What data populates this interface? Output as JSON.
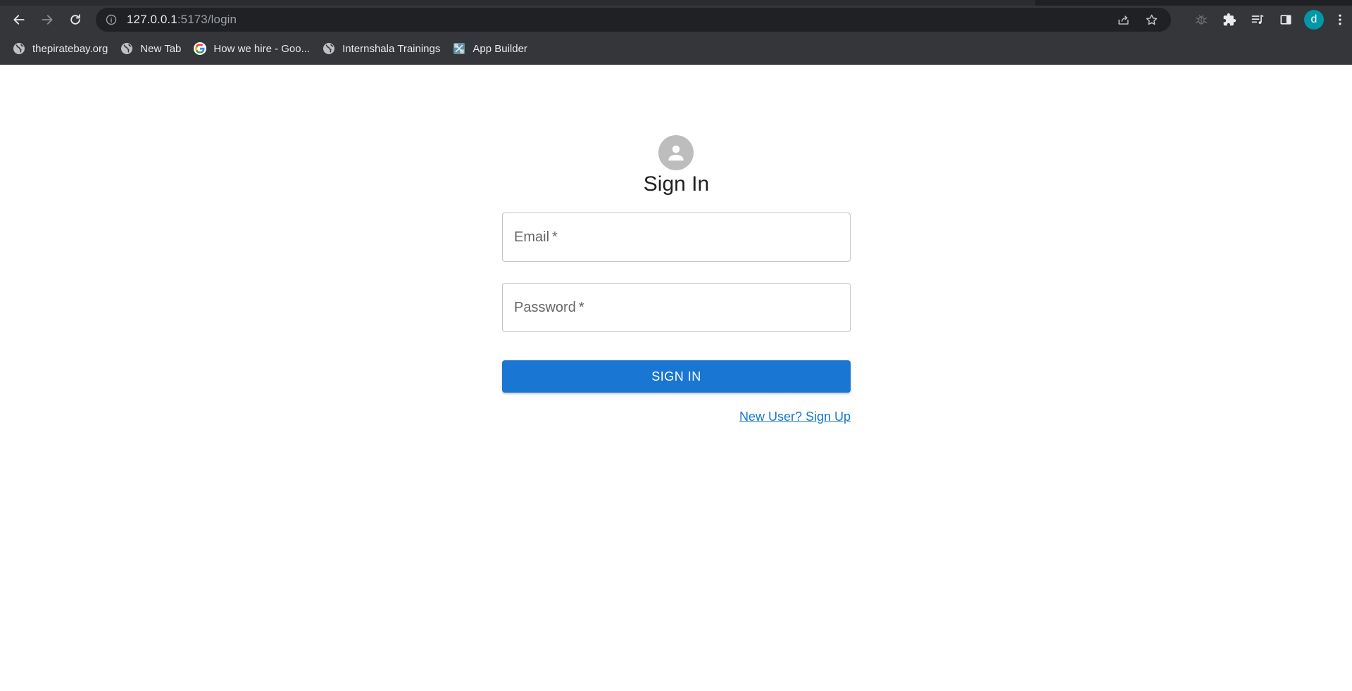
{
  "browser": {
    "url_host": "127.0.0.1",
    "url_rest": ":5173/login",
    "profile_initial": "d",
    "bookmarks": [
      {
        "label": "thepiratebay.org",
        "icon": "globe-icon"
      },
      {
        "label": "New Tab",
        "icon": "globe-icon"
      },
      {
        "label": "How we hire - Goo...",
        "icon": "google-icon"
      },
      {
        "label": "Internshala Trainings",
        "icon": "globe-icon"
      },
      {
        "label": "App Builder",
        "icon": "app-builder-icon"
      }
    ]
  },
  "signin": {
    "title": "Sign In",
    "email_label": "Email",
    "password_label": "Password",
    "required_mark": "*",
    "submit_label": "SIGN IN",
    "signup_link": "New User? Sign Up"
  },
  "colors": {
    "primary": "#1976d2",
    "avatar_bg": "#bdbdbd",
    "chrome_bg": "#35363a",
    "omnibox_bg": "#202124",
    "profile_bg": "#0097a7"
  }
}
